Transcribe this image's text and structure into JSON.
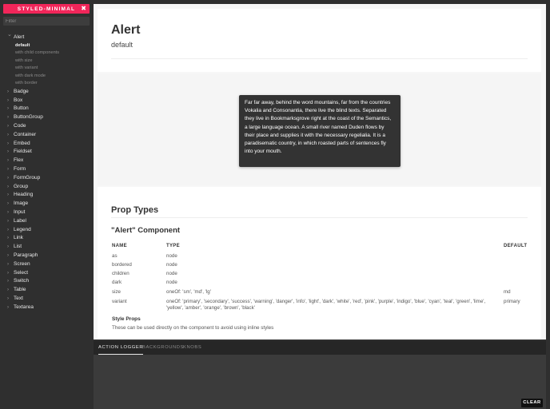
{
  "sidebar": {
    "brand": "STYLED-MINIMAL",
    "close_glyph": "✖",
    "filter_placeholder": "Filter",
    "components": [
      {
        "label": "Alert",
        "expanded": true,
        "stories": [
          {
            "label": "default",
            "active": true
          },
          {
            "label": "with child components",
            "active": false
          },
          {
            "label": "with size",
            "active": false
          },
          {
            "label": "with variant",
            "active": false
          },
          {
            "label": "with dark mode",
            "active": false
          },
          {
            "label": "with border",
            "active": false
          }
        ]
      },
      {
        "label": "Badge"
      },
      {
        "label": "Box"
      },
      {
        "label": "Button"
      },
      {
        "label": "ButtonGroup"
      },
      {
        "label": "Code"
      },
      {
        "label": "Container"
      },
      {
        "label": "Embed"
      },
      {
        "label": "Fieldset"
      },
      {
        "label": "Flex"
      },
      {
        "label": "Form"
      },
      {
        "label": "FormGroup"
      },
      {
        "label": "Group"
      },
      {
        "label": "Heading"
      },
      {
        "label": "Image"
      },
      {
        "label": "Input"
      },
      {
        "label": "Label"
      },
      {
        "label": "Legend"
      },
      {
        "label": "Link"
      },
      {
        "label": "List"
      },
      {
        "label": "Paragraph"
      },
      {
        "label": "Screen"
      },
      {
        "label": "Select"
      },
      {
        "label": "Switch"
      },
      {
        "label": "Table"
      },
      {
        "label": "Text"
      },
      {
        "label": "Textarea"
      }
    ]
  },
  "header": {
    "title": "Alert",
    "subtitle": "default"
  },
  "preview": {
    "alert_text": "Far far away, behind the word mountains, far from the countries Vokalia and Consonantia, there live the blind texts. Separated they live in Bookmarksgrove right at the coast of the Semantics, a large language ocean. A small river named Duden flows by their place and supplies it with the necessary regelialia. It is a paradisematic country, in which roasted parts of sentences fly into your mouth."
  },
  "props": {
    "title": "Prop Types",
    "component_title": "\"Alert\" Component",
    "headers": {
      "name": "NAME",
      "type": "TYPE",
      "default": "DEFAULT"
    },
    "rows": [
      {
        "name": "as",
        "type": "node",
        "default": ""
      },
      {
        "name": "bordered",
        "type": "node",
        "default": ""
      },
      {
        "name": "children",
        "type": "node",
        "default": ""
      },
      {
        "name": "dark",
        "type": "node",
        "default": ""
      },
      {
        "name": "size",
        "type": "oneOf: 'sm', 'md', 'lg'",
        "default": "md"
      },
      {
        "name": "variant",
        "type": "oneOf: 'primary', 'secondary', 'success', 'warning', 'danger', 'info', 'light', 'dark', 'white', 'red', 'pink', 'purple', 'indigo', 'blue', 'cyan', 'teal', 'green', 'lime', 'yellow', 'amber', 'orange', 'brown', 'black'",
        "default": "primary"
      }
    ],
    "styled_title": "Style Props",
    "styled_desc": "These can be used directly on the component to avoid using inline styles"
  },
  "addons": {
    "tabs": [
      {
        "label": "ACTION LOGGER",
        "active": true
      },
      {
        "label": "BACKGROUNDS",
        "active": false
      },
      {
        "label": "KNOBS",
        "active": false
      }
    ],
    "clear_label": "CLEAR"
  },
  "colors": {
    "brand": "#f1265a",
    "sidebar_bg": "#2f2f2f",
    "alert_bg": "#333333"
  }
}
